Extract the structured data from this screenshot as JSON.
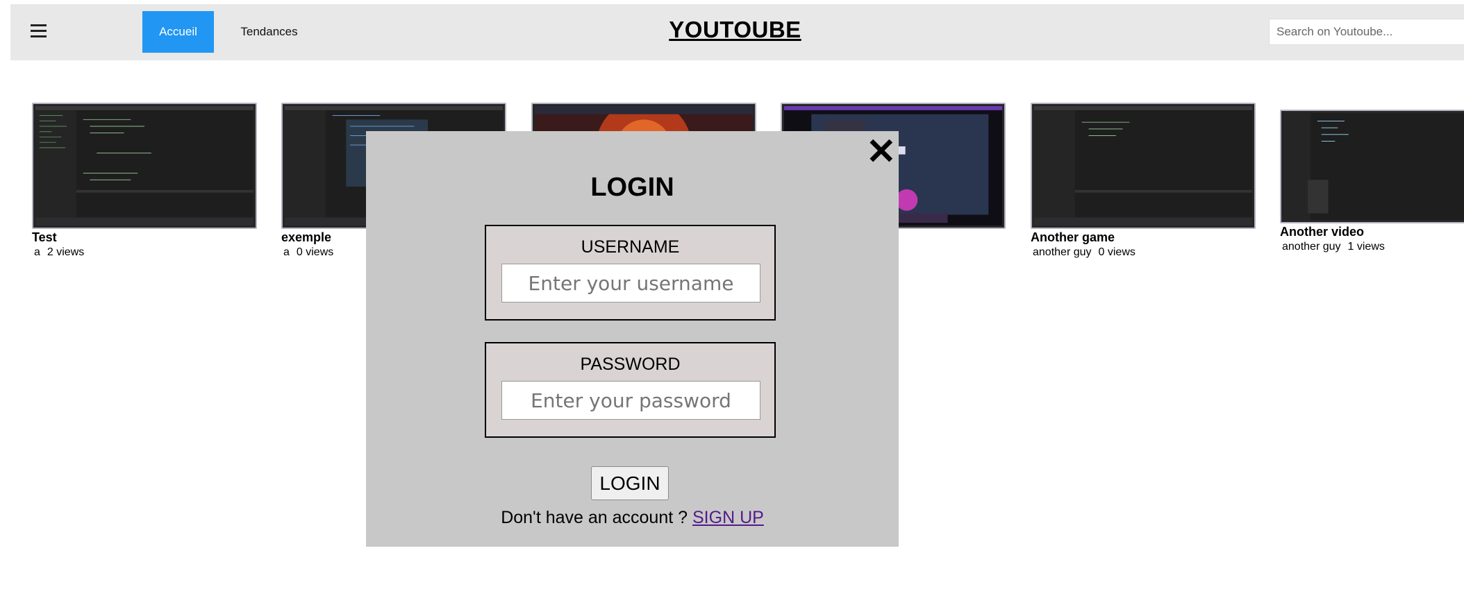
{
  "header": {
    "menu_icon": "hamburger-menu-icon",
    "nav": [
      {
        "label": "Accueil",
        "active": true
      },
      {
        "label": "Tendances",
        "active": false
      }
    ],
    "brand": "YOUTOUBE",
    "search_placeholder": "Search on Youtoube..."
  },
  "colors": {
    "accent": "#2196f3",
    "topbar_bg": "#e8e8e8",
    "modal_bg": "#c8c8c8",
    "field_bg": "#d9d3d3",
    "link": "#551a8b"
  },
  "videos": [
    {
      "title": "Test",
      "author": "a",
      "views": "2 views",
      "thumbnail": "code-editor-screenshot"
    },
    {
      "title": "exemple",
      "author": "a",
      "views": "0 views",
      "thumbnail": "code-editor-screenshot"
    },
    {
      "title": "",
      "author": "",
      "views": "",
      "thumbnail": "game-screenshot-fire"
    },
    {
      "title": "",
      "author": "",
      "views": "",
      "thumbnail": "game-screenshot-topdown"
    },
    {
      "title": "Another game",
      "author": "another guy",
      "views": "0 views",
      "thumbnail": "code-editor-screenshot"
    },
    {
      "title": "Another video",
      "author": "another guy",
      "views": "1 views",
      "thumbnail": "code-editor-screenshot"
    }
  ],
  "login_modal": {
    "close_icon": "close-x-icon",
    "title": "LOGIN",
    "username_label": "USERNAME",
    "username_placeholder": "Enter your username",
    "password_label": "PASSWORD",
    "password_placeholder": "Enter your password",
    "submit_label": "LOGIN",
    "signup_prompt": "Don't have an account ?",
    "signup_link": "SIGN UP"
  }
}
